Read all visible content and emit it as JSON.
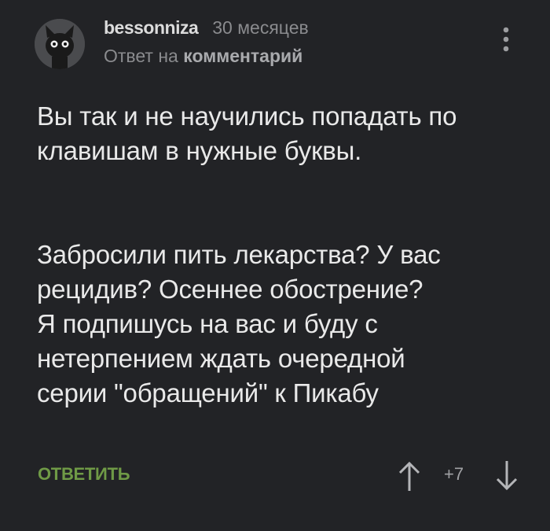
{
  "comment": {
    "author": {
      "username": "bessonniza",
      "avatar_icon": "cat-avatar"
    },
    "time_ago": "30 месяцев",
    "reply_prefix": "Ответ на",
    "reply_target": "комментарий",
    "menu_icon": "vertical-dots-icon",
    "paragraphs": [
      [
        "Вы так и не научились попадать по",
        "клавишам в нужные буквы."
      ],
      [
        "Забросили пить лекарства? У вас",
        "рецидив? Осеннее обострение?",
        "Я подпишусь на вас и буду с",
        "нетерпением ждать очередной",
        "серии \"обращений\" к Пикабу"
      ]
    ],
    "actions": {
      "reply_label": "ОТВЕТИТЬ",
      "rating": "+7",
      "upvote_icon": "arrow-up-icon",
      "downvote_icon": "arrow-down-icon"
    }
  },
  "colors": {
    "background": "#222326",
    "text": "#e9e9e9",
    "muted": "#8a8b8e",
    "accent_green": "#6f9a46"
  }
}
